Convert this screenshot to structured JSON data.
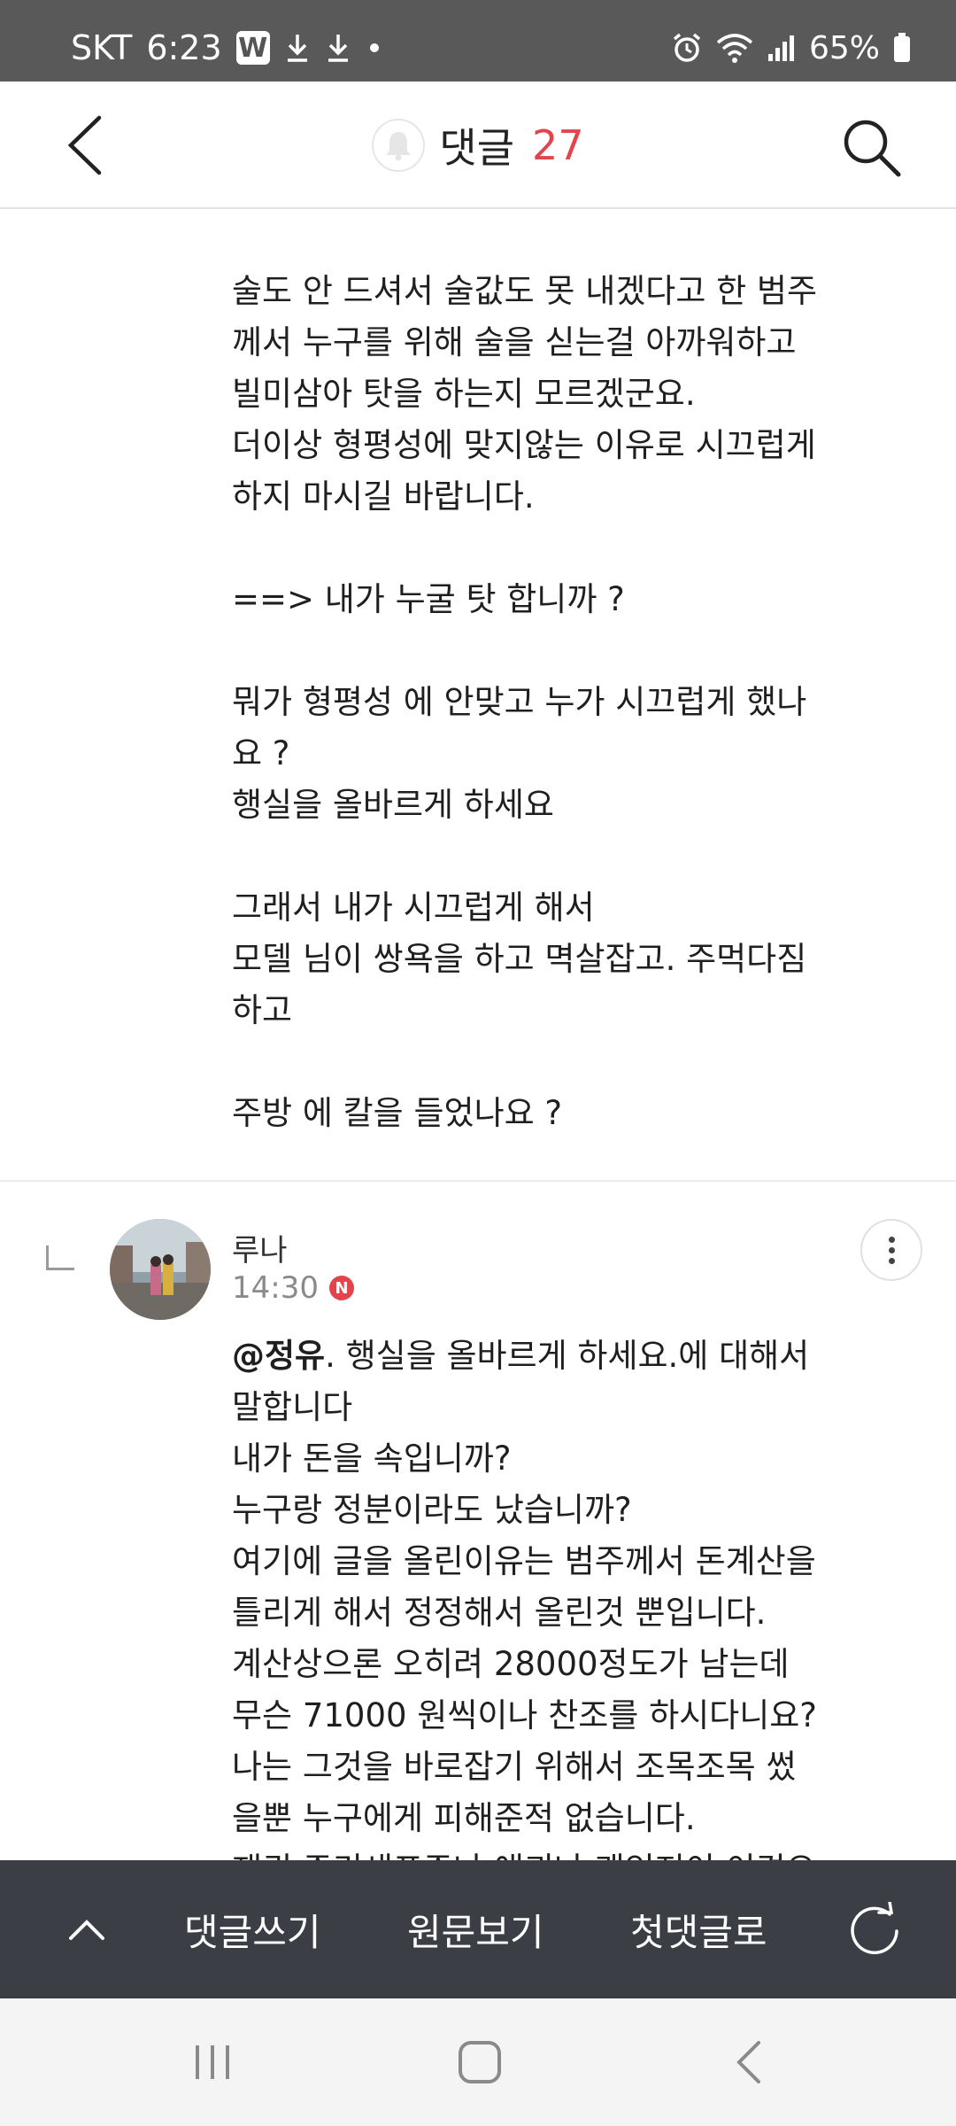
{
  "status_bar": {
    "carrier": "SKT",
    "time": "6:23",
    "app_badge": "W",
    "battery": "65%"
  },
  "header": {
    "title": "댓글",
    "count": "27"
  },
  "comments": [
    {
      "body": "술도 안 드셔서 술값도 못 내겠다고 한 범주\n께서 누구를 위해 술을 싣는걸 아까워하고\n빌미삼아 탓을 하는지 모르겠군요.\n더이상 형평성에 맞지않는 이유로 시끄럽게\n하지 마시길 바랍니다.\n\n==> 내가 누굴 탓 합니까 ?\n\n뭐가 형평성 에 안맞고 누가 시끄럽게 했나\n요 ?\n행실을 올바르게 하세요\n\n그래서 내가 시끄럽게 해서\n모델 님이 쌍욕을 하고 멱살잡고. 주먹다짐\n하고\n\n주방 에 칼을 들었나요 ?"
    },
    {
      "author": "루나",
      "time": "14:30",
      "new_badge": "N",
      "mention": "@정유",
      "body": ". 행실을 올바르게 하세요.에 대해서\n말합니다\n내가 돈을 속입니까?\n누구랑 정분이라도 났습니까?\n여기에 글을 올린이유는 범주께서 돈계산을\n틀리게 해서 정정해서 올린것 뿐입니다.\n계산상으론 오히려 28000정도가 남는데\n무슨 71000 원씩이나 찬조를 하시다니요?\n나는 그것을 바로잡기 위해서 조목조목 썼\n을뿐 누구에게 피해준적 없습니다.\n재귀 주리새표주나 애괴나 괘인저이 이견으"
    }
  ],
  "toolbar": {
    "write_label": "댓글쓰기",
    "original_label": "원문보기",
    "first_label": "첫댓글로"
  },
  "colors": {
    "accent": "#e3434b",
    "toolbar_bg": "#3b3e45",
    "status_bg": "#595959"
  },
  "icons": {
    "back": "chevron-left-icon",
    "search": "search-icon",
    "bell": "bell-icon",
    "more": "more-vertical-icon",
    "up": "chevron-up-icon",
    "refresh": "refresh-icon"
  }
}
